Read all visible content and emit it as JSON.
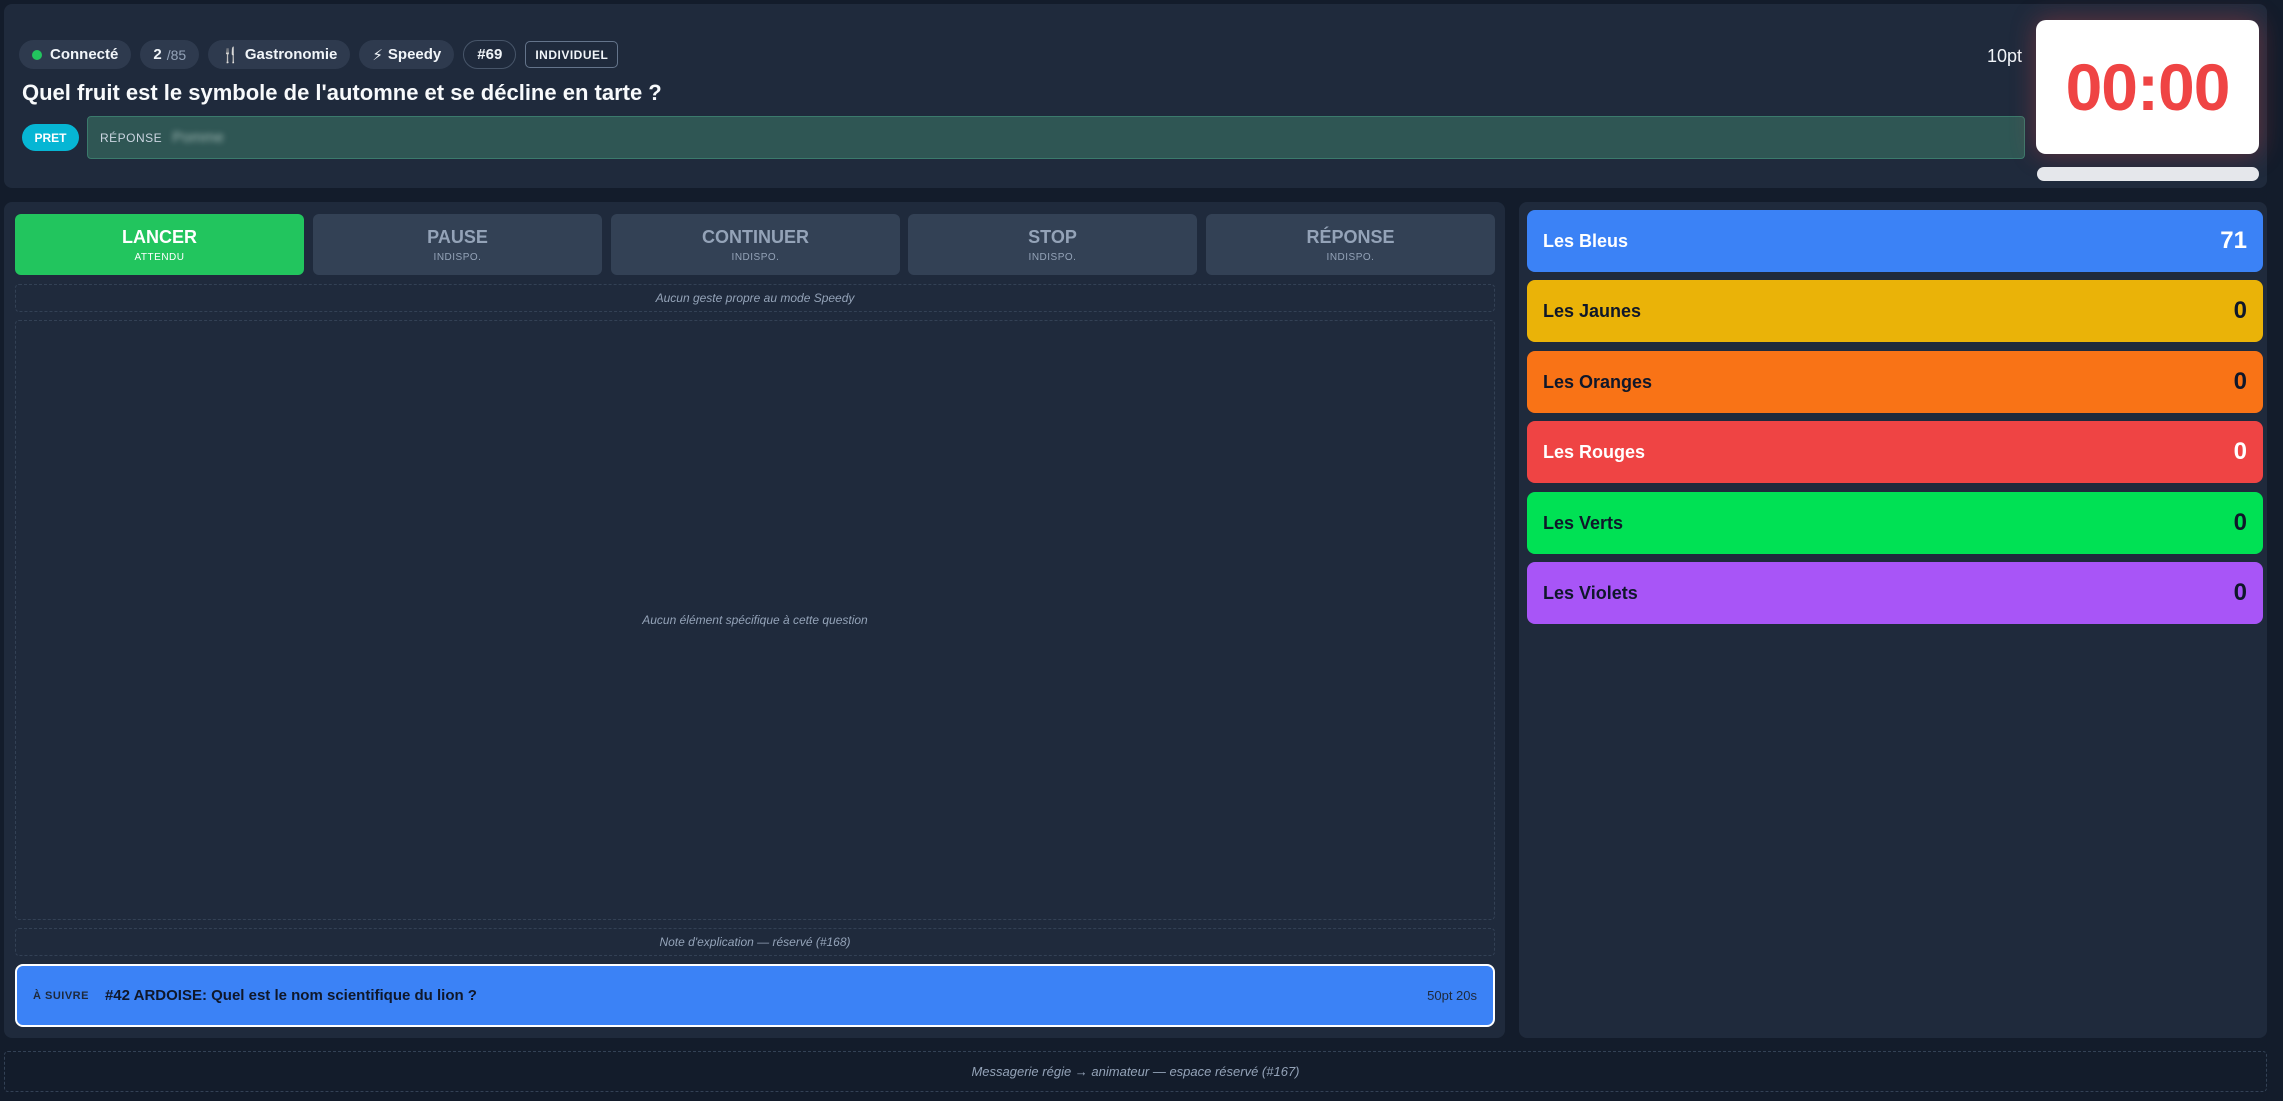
{
  "header": {
    "status": "Connecté",
    "question_index": "2",
    "question_total": "/85",
    "category_icon": "🍴",
    "category": "Gastronomie",
    "mode_icon": "⚡",
    "mode": "Speedy",
    "question_id": "#69",
    "format": "INDIVIDUEL",
    "points": "10pt",
    "question": "Quel fruit est le symbole de l'automne et se décline en tarte ?",
    "ready_badge": "PRET",
    "answer_label": "RÉPONSE",
    "answer_value": "Pomme",
    "timer": "00:00"
  },
  "controls": [
    {
      "label": "LANCER",
      "sub": "ATTENDU"
    },
    {
      "label": "PAUSE",
      "sub": "INDISPO."
    },
    {
      "label": "CONTINUER",
      "sub": "INDISPO."
    },
    {
      "label": "STOP",
      "sub": "INDISPO."
    },
    {
      "label": "RÉPONSE",
      "sub": "INDISPO."
    }
  ],
  "notes": {
    "mode": "Aucun geste propre au mode Speedy",
    "specific": "Aucun élément spécifique à cette question",
    "explanation": "Note d'explication — réservé (#168)"
  },
  "next": {
    "label": "À SUIVRE",
    "text": "#42 ARDOISE: Quel est le nom scientifique du lion ?",
    "meta": "50pt 20s"
  },
  "teams": [
    {
      "name": "Les Bleus",
      "score": "71",
      "color": "#3b82f6",
      "text_color": "#ffffff"
    },
    {
      "name": "Les Jaunes",
      "score": "0",
      "color": "#eab308",
      "text_color": "#0f172a"
    },
    {
      "name": "Les Oranges",
      "score": "0",
      "color": "#f97316",
      "text_color": "#0f172a"
    },
    {
      "name": "Les Rouges",
      "score": "0",
      "color": "#ef4444",
      "text_color": "#ffffff"
    },
    {
      "name": "Les Verts",
      "score": "0",
      "color": "#00e154",
      "text_color": "#0f172a"
    },
    {
      "name": "Les Violets",
      "score": "0",
      "color": "#a855f7",
      "text_color": "#0f172a"
    }
  ],
  "footer": "Messagerie régie → animateur — espace réservé (#167)"
}
